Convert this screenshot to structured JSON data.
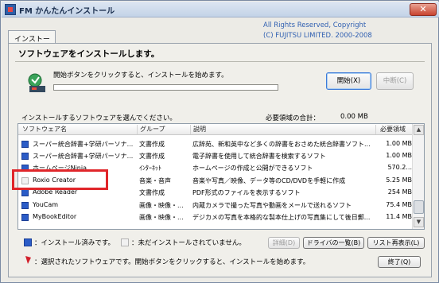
{
  "window": {
    "title": "FM かんたんインストール",
    "close_label": "✕"
  },
  "copyright": {
    "line1": "All Rights Reserved, Copyright",
    "line2": "(C) FUJITSU LIMITED. 2000-2008"
  },
  "tab": {
    "label": "インストール"
  },
  "heading": "ソフトウェアをインストールします。",
  "status": {
    "text": "開始ボタンをクリックすると、インストールを始めます。",
    "progress": 0
  },
  "buttons": {
    "start": "開始(X)",
    "stop": "中断(C)",
    "details": "詳細(D)",
    "driver_list": "ドライバの一覧(B)",
    "redisplay": "リスト再表示(L)",
    "exit": "終了(Q)"
  },
  "select_text": "インストールするソフトウェアを選んでください。",
  "space": {
    "label": "必要領域の合計：",
    "value": "0.00 MB"
  },
  "table": {
    "headers": {
      "name": "ソフトウェア名",
      "group": "グループ",
      "desc": "説明",
      "size": "必要領域"
    },
    "rows": [
      {
        "name": "スーパー統合辞書+学研パーソナ...",
        "group": "文書作成",
        "desc": "広辞苑、新和英中など多くの辞書をおさめた統合辞書ソフト...",
        "size": "1.00 MB",
        "installed": true
      },
      {
        "name": "スーパー統合辞書+学研パーソナ...",
        "group": "文書作成",
        "desc": "電子辞書を使用して統合辞書を検索するソフト",
        "size": "1.00 MB",
        "installed": true
      },
      {
        "name": "ホームページNinja",
        "group": "ｲﾝﾀｰﾈｯﾄ",
        "desc": "ホームページの作成と公開ができるソフト",
        "size": "570.2...",
        "installed": true
      },
      {
        "name": "Roxio Creator",
        "group": "音楽・音声",
        "desc": "音楽や写真／映像、データ等のCD/DVDを手軽に作成",
        "size": "5.25 MB",
        "installed": false
      },
      {
        "name": "Adobe Reader",
        "group": "文書作成",
        "desc": "PDF形式のファイルを表示するソフト",
        "size": "254 MB",
        "installed": true
      },
      {
        "name": "YouCam",
        "group": "画像・映像・...",
        "desc": "内蔵カメラで撮った写真や動画をメールで送れるソフト",
        "size": "75.4 MB",
        "installed": true
      },
      {
        "name": "MyBookEditor",
        "group": "画像・映像・...",
        "desc": "デジカメの写真を本格的な製本仕上げの写真集にして後日郵...",
        "size": "11.4 MB",
        "installed": true
      }
    ]
  },
  "legend": {
    "installed": "：インストール済みです。",
    "not_installed": "：未だインストールされていません。",
    "selected": "：選択されたソフトウェアです。開始ボタンをクリックすると、インストールを始めます。"
  },
  "colors": {
    "accent": "#2f5fb1",
    "highlight": "#e0262a"
  }
}
